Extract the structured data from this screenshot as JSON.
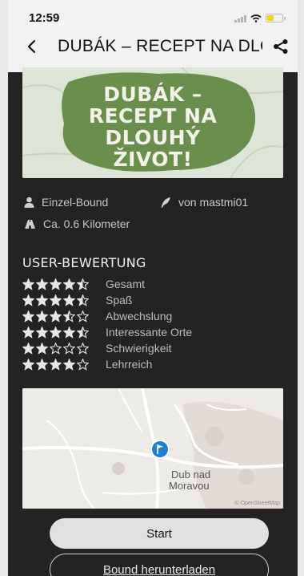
{
  "status_bar": {
    "time": "12:59",
    "battery_level": 0.4,
    "battery_color": "#f2d21f"
  },
  "header": {
    "title": "DUBÁK – RECEPT NA DLOUHÝ ŽIVOT!",
    "back_icon": "chevron-left-icon",
    "share_icon": "share-icon"
  },
  "banner": {
    "lines": [
      "DUBÁK –",
      "RECEPT NA",
      "DLOUHÝ",
      "ŽIVOT!"
    ],
    "blob_color": "#6a8e4b"
  },
  "info": {
    "type_label": "Einzel-Bound",
    "author_label": "von mastmi01",
    "distance_label": "Ca. 0.6 Kilometer"
  },
  "ratings": {
    "heading": "USER-BEWERTUNG",
    "items": [
      {
        "label": "Gesamt",
        "value": 4.5
      },
      {
        "label": "Spaß",
        "value": 4.5
      },
      {
        "label": "Abwechslung",
        "value": 3.5
      },
      {
        "label": "Interessante Orte",
        "value": 4.5
      },
      {
        "label": "Schwierigkeit",
        "value": 2
      },
      {
        "label": "Lehrreich",
        "value": 4
      }
    ]
  },
  "map": {
    "town_label_1": "Dub nad",
    "town_label_2": "Moravou",
    "credit": "© OpenStreetMap",
    "pin_color": "#1f7fd1"
  },
  "actions": {
    "start_label": "Start",
    "download_label": "Bound herunterladen"
  }
}
